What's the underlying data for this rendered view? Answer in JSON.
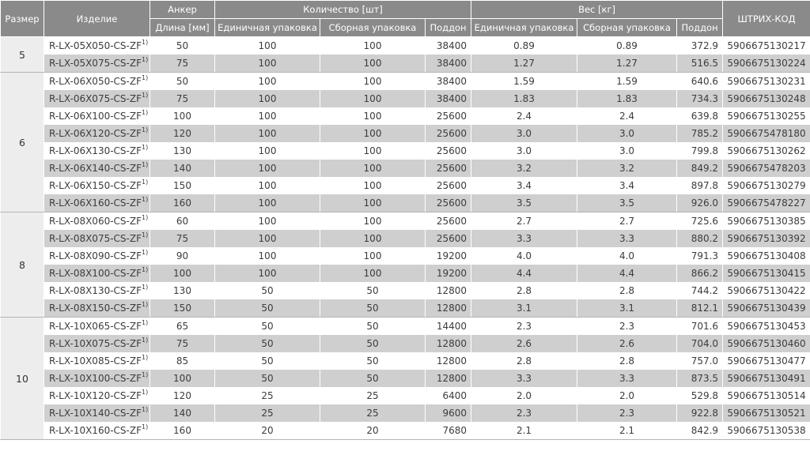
{
  "header": {
    "size": "Размер",
    "product": "Изделие",
    "anchor": "Анкер",
    "anchor_length": "Длина [мм]",
    "quantity": "Количество [шт]",
    "qty_unit": "Единичная упаковка",
    "qty_bulk": "Сборная упаковка",
    "qty_pallet": "Поддон",
    "weight": "Вес [кг]",
    "w_unit": "Единичная упаковка",
    "w_bulk": "Сборная упаковка",
    "w_pallet": "Поддон",
    "barcode": "ШТРИХ-КОД"
  },
  "footnote_mark": "1)",
  "groups": [
    {
      "size": "5",
      "rows": [
        {
          "product": "R-LX-05X050-CS-ZF",
          "length": "50",
          "qu": "100",
          "qb": "100",
          "qp": "38400",
          "wu": "0.89",
          "wb": "0.89",
          "wp": "372.9",
          "code": "5906675130217"
        },
        {
          "product": "R-LX-05X075-CS-ZF",
          "length": "75",
          "qu": "100",
          "qb": "100",
          "qp": "38400",
          "wu": "1.27",
          "wb": "1.27",
          "wp": "516.5",
          "code": "5906675130224"
        }
      ]
    },
    {
      "size": "6",
      "rows": [
        {
          "product": "R-LX-06X050-CS-ZF",
          "length": "50",
          "qu": "100",
          "qb": "100",
          "qp": "38400",
          "wu": "1.59",
          "wb": "1.59",
          "wp": "640.6",
          "code": "5906675130231"
        },
        {
          "product": "R-LX-06X075-CS-ZF",
          "length": "75",
          "qu": "100",
          "qb": "100",
          "qp": "38400",
          "wu": "1.83",
          "wb": "1.83",
          "wp": "734.3",
          "code": "5906675130248"
        },
        {
          "product": "R-LX-06X100-CS-ZF",
          "length": "100",
          "qu": "100",
          "qb": "100",
          "qp": "25600",
          "wu": "2.4",
          "wb": "2.4",
          "wp": "639.8",
          "code": "5906675130255"
        },
        {
          "product": "R-LX-06X120-CS-ZF",
          "length": "120",
          "qu": "100",
          "qb": "100",
          "qp": "25600",
          "wu": "3.0",
          "wb": "3.0",
          "wp": "785.2",
          "code": "5906675478180"
        },
        {
          "product": "R-LX-06X130-CS-ZF",
          "length": "130",
          "qu": "100",
          "qb": "100",
          "qp": "25600",
          "wu": "3.0",
          "wb": "3.0",
          "wp": "799.8",
          "code": "5906675130262"
        },
        {
          "product": "R-LX-06X140-CS-ZF",
          "length": "140",
          "qu": "100",
          "qb": "100",
          "qp": "25600",
          "wu": "3.2",
          "wb": "3.2",
          "wp": "849.2",
          "code": "5906675478203"
        },
        {
          "product": "R-LX-06X150-CS-ZF",
          "length": "150",
          "qu": "100",
          "qb": "100",
          "qp": "25600",
          "wu": "3.4",
          "wb": "3.4",
          "wp": "897.8",
          "code": "5906675130279"
        },
        {
          "product": "R-LX-06X160-CS-ZF",
          "length": "160",
          "qu": "100",
          "qb": "100",
          "qp": "25600",
          "wu": "3.5",
          "wb": "3.5",
          "wp": "926.0",
          "code": "5906675478227"
        }
      ]
    },
    {
      "size": "8",
      "rows": [
        {
          "product": "R-LX-08X060-CS-ZF",
          "length": "60",
          "qu": "100",
          "qb": "100",
          "qp": "25600",
          "wu": "2.7",
          "wb": "2.7",
          "wp": "725.6",
          "code": "5906675130385"
        },
        {
          "product": "R-LX-08X075-CS-ZF",
          "length": "75",
          "qu": "100",
          "qb": "100",
          "qp": "25600",
          "wu": "3.3",
          "wb": "3.3",
          "wp": "880.2",
          "code": "5906675130392"
        },
        {
          "product": "R-LX-08X090-CS-ZF",
          "length": "90",
          "qu": "100",
          "qb": "100",
          "qp": "19200",
          "wu": "4.0",
          "wb": "4.0",
          "wp": "791.3",
          "code": "5906675130408"
        },
        {
          "product": "R-LX-08X100-CS-ZF",
          "length": "100",
          "qu": "100",
          "qb": "100",
          "qp": "19200",
          "wu": "4.4",
          "wb": "4.4",
          "wp": "866.2",
          "code": "5906675130415"
        },
        {
          "product": "R-LX-08X130-CS-ZF",
          "length": "130",
          "qu": "50",
          "qb": "50",
          "qp": "12800",
          "wu": "2.8",
          "wb": "2.8",
          "wp": "744.2",
          "code": "5906675130422"
        },
        {
          "product": "R-LX-08X150-CS-ZF",
          "length": "150",
          "qu": "50",
          "qb": "50",
          "qp": "12800",
          "wu": "3.1",
          "wb": "3.1",
          "wp": "812.1",
          "code": "5906675130439"
        }
      ]
    },
    {
      "size": "10",
      "rows": [
        {
          "product": "R-LX-10X065-CS-ZF",
          "length": "65",
          "qu": "50",
          "qb": "50",
          "qp": "14400",
          "wu": "2.3",
          "wb": "2.3",
          "wp": "701.6",
          "code": "5906675130453"
        },
        {
          "product": "R-LX-10X075-CS-ZF",
          "length": "75",
          "qu": "50",
          "qb": "50",
          "qp": "12800",
          "wu": "2.6",
          "wb": "2.6",
          "wp": "704.0",
          "code": "5906675130460"
        },
        {
          "product": "R-LX-10X085-CS-ZF",
          "length": "85",
          "qu": "50",
          "qb": "50",
          "qp": "12800",
          "wu": "2.8",
          "wb": "2.8",
          "wp": "757.0",
          "code": "5906675130477"
        },
        {
          "product": "R-LX-10X100-CS-ZF",
          "length": "100",
          "qu": "50",
          "qb": "50",
          "qp": "12800",
          "wu": "3.3",
          "wb": "3.3",
          "wp": "873.5",
          "code": "5906675130491"
        },
        {
          "product": "R-LX-10X120-CS-ZF",
          "length": "120",
          "qu": "25",
          "qb": "25",
          "qp": "6400",
          "wu": "2.0",
          "wb": "2.0",
          "wp": "529.8",
          "code": "5906675130514"
        },
        {
          "product": "R-LX-10X140-CS-ZF",
          "length": "140",
          "qu": "25",
          "qb": "25",
          "qp": "9600",
          "wu": "2.3",
          "wb": "2.3",
          "wp": "922.8",
          "code": "5906675130521"
        },
        {
          "product": "R-LX-10X160-CS-ZF",
          "length": "160",
          "qu": "20",
          "qb": "20",
          "qp": "7680",
          "wu": "2.1",
          "wb": "2.1",
          "wp": "842.9",
          "code": "5906675130538"
        }
      ]
    }
  ]
}
